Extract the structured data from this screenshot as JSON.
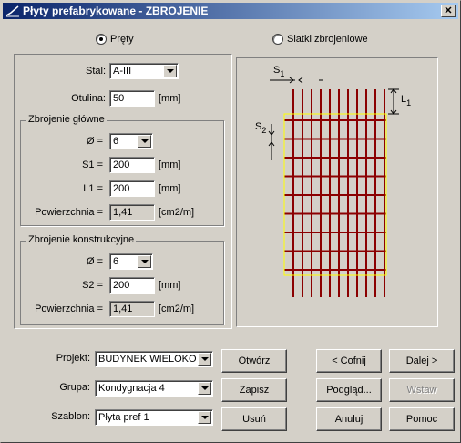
{
  "window": {
    "title": "Płyty prefabrykowane - ZBROJENIE",
    "close": "✕"
  },
  "mode": {
    "option1": "Pręty",
    "option2": "Siatki zbrojeniowe",
    "selected": "Pręty"
  },
  "main": {
    "stal_label": "Stal:",
    "stal_value": "A-III",
    "otulina_label": "Otulina:",
    "otulina_value": "50",
    "otulina_unit": "[mm]"
  },
  "glowne": {
    "title": "Zbrojenie główne",
    "phi_label": "Ø =",
    "phi_value": "6",
    "s1_label": "S1 =",
    "s1_value": "200",
    "s1_unit": "[mm]",
    "l1_label": "L1 =",
    "l1_value": "200",
    "l1_unit": "[mm]",
    "pow_label": "Powierzchnia =",
    "pow_value": "1,41",
    "pow_unit": "[cm2/m]"
  },
  "konstrukcyjne": {
    "title": "Zbrojenie konstrukcyjne",
    "phi_label": "Ø =",
    "phi_value": "6",
    "s2_label": "S2 =",
    "s2_value": "200",
    "s2_unit": "[mm]",
    "pow_label": "Powierzchnia =",
    "pow_value": "1,41",
    "pow_unit": "[cm2/m]"
  },
  "diagram": {
    "s1_letter": "S",
    "s1_sub": "1",
    "s2_letter": "S",
    "s2_sub": "2",
    "l1_letter": "L",
    "l1_sub": "1",
    "bar_color": "#8b0000",
    "plate_color": "#ffff00"
  },
  "bottom": {
    "projekt_label": "Projekt:",
    "projekt_value": "BUDYNEK WIELOKONDYGNACYJNY",
    "grupa_label": "Grupa:",
    "grupa_value": "Kondygnacja 4",
    "szablon_label": "Szablon:",
    "szablon_value": "Płyta pref 1",
    "otworz": "Otwórz",
    "zapisz": "Zapisz",
    "usun": "Usuń",
    "cofnij": "< Cofnij",
    "dalej": "Dalej >",
    "podglad": "Podgląd...",
    "wstaw": "Wstaw",
    "anuluj": "Anuluj",
    "pomoc": "Pomoc"
  }
}
